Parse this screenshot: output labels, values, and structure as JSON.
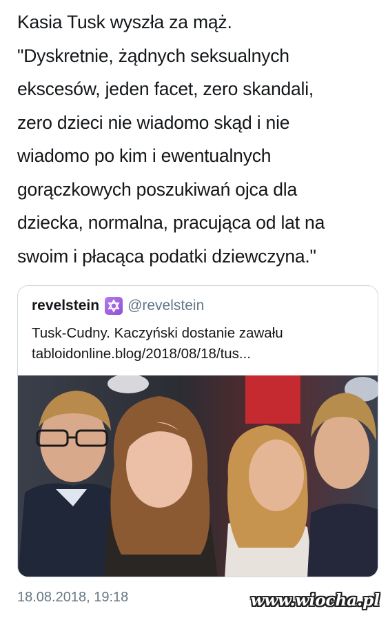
{
  "tweet": {
    "text_lines": [
      "Kasia Tusk wyszła za mąż.",
      "\"Dyskretnie, żądnych seksualnych",
      "ekscesów, jeden facet, zero skandali,",
      "zero dzieci nie wiadomo skąd i nie",
      "wiadomo po kim i ewentualnych",
      "gorączkowych poszukiwań ojca dla",
      "dziecka, normalna, pracująca od lat na",
      "swoim i płacąca podatki dziewczyna.\""
    ],
    "timestamp": "18.08.2018, 19:18"
  },
  "quote": {
    "display_name": "revelstein",
    "badge_icon": "star-of-david-icon",
    "handle": "@revelstein",
    "text_lines": [
      "Tusk-Cudny. Kaczyński dostanie zawału",
      "tabloidonline.blog/2018/08/18/tus..."
    ],
    "photo": "photo of four young people at an event"
  },
  "watermark": "www.wiocha.pl",
  "colors": {
    "text": "#14171a",
    "secondary": "#657786",
    "border": "#cfd9de",
    "badge": "#9b5de5"
  }
}
